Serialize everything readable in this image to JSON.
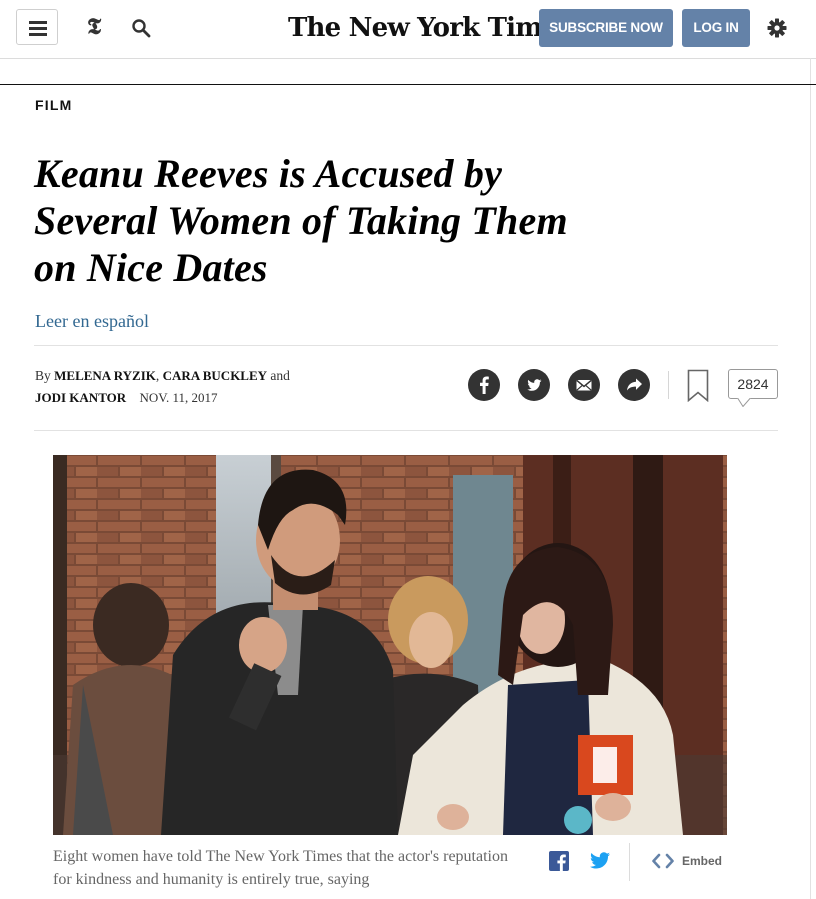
{
  "header": {
    "logo": "The New York Times",
    "subscribe_label": "SUBSCRIBE NOW",
    "login_label": "LOG IN",
    "icons": [
      "menu-icon",
      "t-logo-icon",
      "search-icon",
      "gear-icon"
    ],
    "accent_color": "#6482a8"
  },
  "article": {
    "section": "FILM",
    "headline": "Keanu Reeves is Accused by Several Women of Taking Them on Nice Dates",
    "lang_link": "Leer en español",
    "byline_prefix": "By",
    "author1": "MELENA RYZIK",
    "author2": "CARA BUCKLEY",
    "byline_and": "and",
    "author3": "JODI KANTOR",
    "date": "NOV. 11, 2017",
    "comment_count": "2824"
  },
  "share": {
    "icons": [
      "facebook-icon",
      "twitter-icon",
      "email-icon",
      "share-icon",
      "bookmark-icon"
    ]
  },
  "photo": {
    "caption": "Eight women have told The New York Times that the actor's reputation for kindness and humanity is entirely true, saying",
    "embed_label": "Embed"
  }
}
